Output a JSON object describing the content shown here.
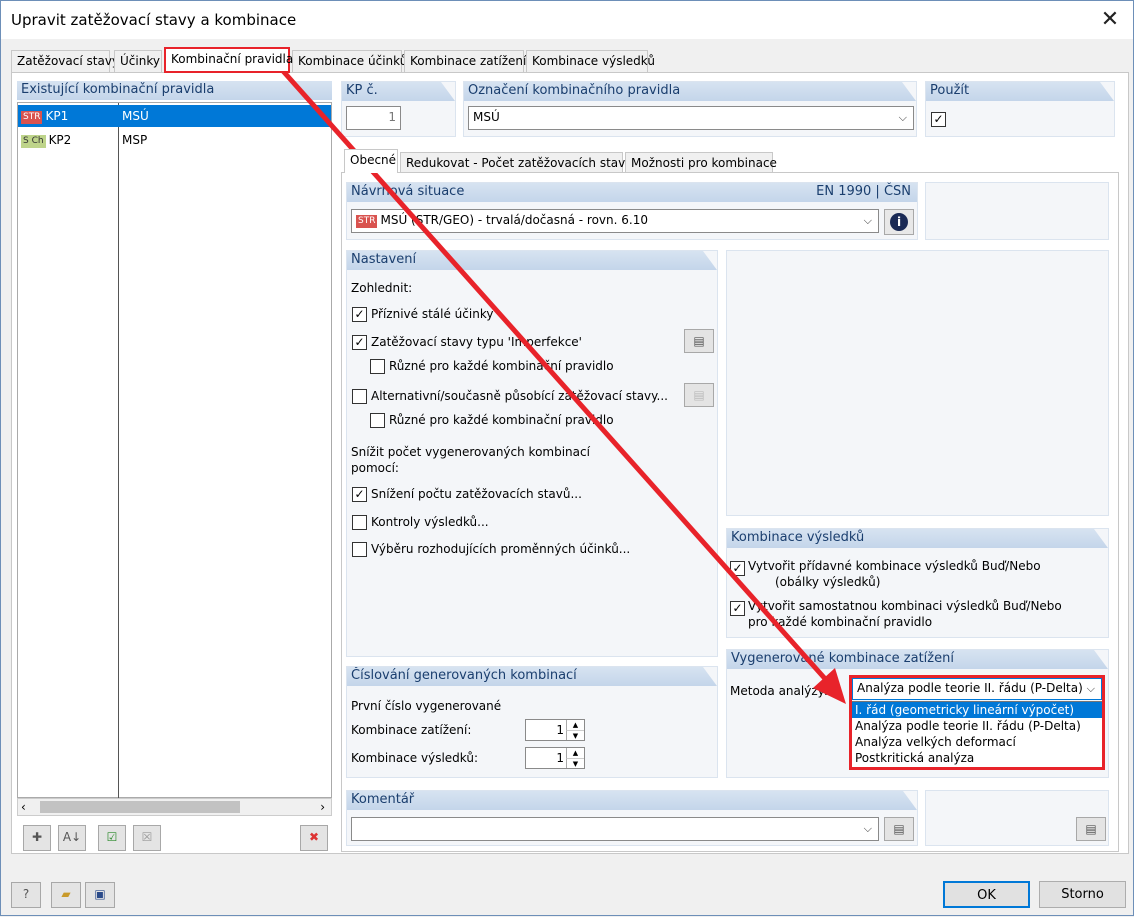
{
  "window": {
    "title": "Upravit zatěžovací stavy a kombinace"
  },
  "main_tabs": [
    "Zatěžovací stavy",
    "Účinky",
    "Kombinační pravidla",
    "Kombinace účinků",
    "Kombinace zatížení",
    "Kombinace výsledků"
  ],
  "active_tab": "Kombinační pravidla",
  "left": {
    "header": "Existující kombinační pravidla",
    "rows": [
      {
        "tag": "STR",
        "id": "KP1",
        "name": "MSÚ"
      },
      {
        "tag": "S Ch",
        "id": "KP2",
        "name": "MSP"
      }
    ]
  },
  "kp": {
    "label": "KP č.",
    "value": "1"
  },
  "oznaceni": {
    "label": "Označení kombinačního pravidla",
    "value": "MSÚ"
  },
  "pouzit": {
    "label": "Použít"
  },
  "sub_tabs": [
    "Obecné",
    "Redukovat - Počet zatěžovacích stavů",
    "Možnosti pro kombinace"
  ],
  "navrh": {
    "label": "Návrhová situace",
    "norm": "EN 1990 | ČSN",
    "tag": "STR",
    "value": "MSÚ (STR/GEO) - trvalá/dočasná - rovn. 6.10"
  },
  "nastaveni": {
    "label": "Nastavení",
    "zohlednit": "Zohlednit:",
    "c1": "Příznivé stálé účinky",
    "c2": "Zatěžovací stavy typu 'Imperfekce'",
    "c2a": "Různé pro každé kombinační pravidlo",
    "c3": "Alternativní/současně působící zatěžovací stavy...",
    "c3a": "Různé pro každé kombinační pravidlo",
    "snizit": "Snížit počet vygenerovaných kombinací",
    "pomoci": "pomocí:",
    "c4": "Snížení počtu zatěžovacích stavů...",
    "c5": "Kontroly výsledků...",
    "c6": "Výběru rozhodujících proměnných účinků..."
  },
  "kombinace_vysledku": {
    "label": "Kombinace výsledků",
    "c1a": "Vytvořit přídavné kombinace výsledků Buď/Nebo",
    "c1b": "(obálky výsledků)",
    "c2a": "Vytvořit samostatnou kombinaci výsledků Buď/Nebo",
    "c2b": "pro každé kombinační pravidlo"
  },
  "cislovani": {
    "label": "Číslování generovaných kombinací",
    "prvni": "První číslo vygenerované",
    "kz": "Kombinace zatížení:",
    "kz_val": "1",
    "kv": "Kombinace výsledků:",
    "kv_val": "1"
  },
  "vygenerovane": {
    "label": "Vygenerované kombinace zatížení",
    "metoda": "Metoda analýzy:",
    "value": "Analýza podle teorie II. řádu (P-Delta)",
    "options": [
      "I. řád (geometricky lineární výpočet)",
      "Analýza podle teorie II. řádu (P-Delta)",
      "Analýza velkých deformací",
      "Postkritická analýza"
    ]
  },
  "komentar": {
    "label": "Komentář",
    "value": ""
  },
  "buttons": {
    "ok": "OK",
    "storno": "Storno"
  },
  "colors": {
    "accent": "#0078d7",
    "annotation": "#e8232a",
    "header": "#c8d8ec"
  }
}
